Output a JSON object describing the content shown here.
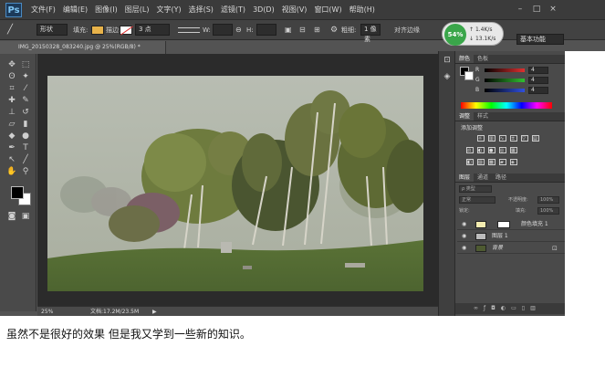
{
  "app": {
    "logo": "Ps"
  },
  "menu": [
    "文件(F)",
    "编辑(E)",
    "图像(I)",
    "图层(L)",
    "文字(Y)",
    "选择(S)",
    "滤镜(T)",
    "3D(D)",
    "视图(V)",
    "窗口(W)",
    "帮助(H)"
  ],
  "window_buttons": [
    "–",
    "□",
    "×"
  ],
  "options_bar": {
    "mode": "形状",
    "fill_label": "填充:",
    "stroke_label": "描边:",
    "stroke_width": "3 点",
    "w_label": "W:",
    "h_label": "H:",
    "weight_label": "粗细:",
    "weight_value": "1 像素",
    "align_label": "对齐边缘",
    "colors": {
      "fill": "#e8b34a",
      "stroke": "#ffffff"
    }
  },
  "network": {
    "percent": "54%",
    "up": "1.4K/s",
    "down": "13.1K/s",
    "color": "#3aa64a"
  },
  "workspace": "基本功能",
  "document": {
    "tab": "IMG_20150328_083240.jpg @ 25%(RGB/8) *"
  },
  "status": {
    "zoom": "25%",
    "doc": "文档:17.2M/23.5M"
  },
  "color_panel": {
    "tabs": [
      "颜色",
      "色板"
    ],
    "channels": [
      {
        "label": "R",
        "value": "4",
        "color": "#e03030"
      },
      {
        "label": "G",
        "value": "4",
        "color": "#30c030"
      },
      {
        "label": "B",
        "value": "4",
        "color": "#3050e0"
      }
    ]
  },
  "adjust_panel": {
    "tabs": [
      "调整",
      "样式"
    ],
    "title": "添加调整"
  },
  "layers_panel": {
    "tabs": [
      "图层",
      "通道",
      "路径"
    ],
    "kind": "ρ 类型",
    "blend_mode": "正常",
    "opacity_label": "不透明度:",
    "opacity_value": "100%",
    "lock_label": "锁定:",
    "fill_label": "填充:",
    "fill_value": "100%",
    "layers": [
      {
        "name": "颜色填充 1",
        "thumb": "fill",
        "thumb_color": "#f4ecb0"
      },
      {
        "name": "图层 1",
        "thumb": "pattern",
        "thumb_color": "#bcbcbc"
      },
      {
        "name": "背景",
        "thumb": "photo",
        "thumb_color": "#4e5a32"
      }
    ]
  },
  "caption": "虽然不是很好的效果  但是我又学到一些新的知识。"
}
